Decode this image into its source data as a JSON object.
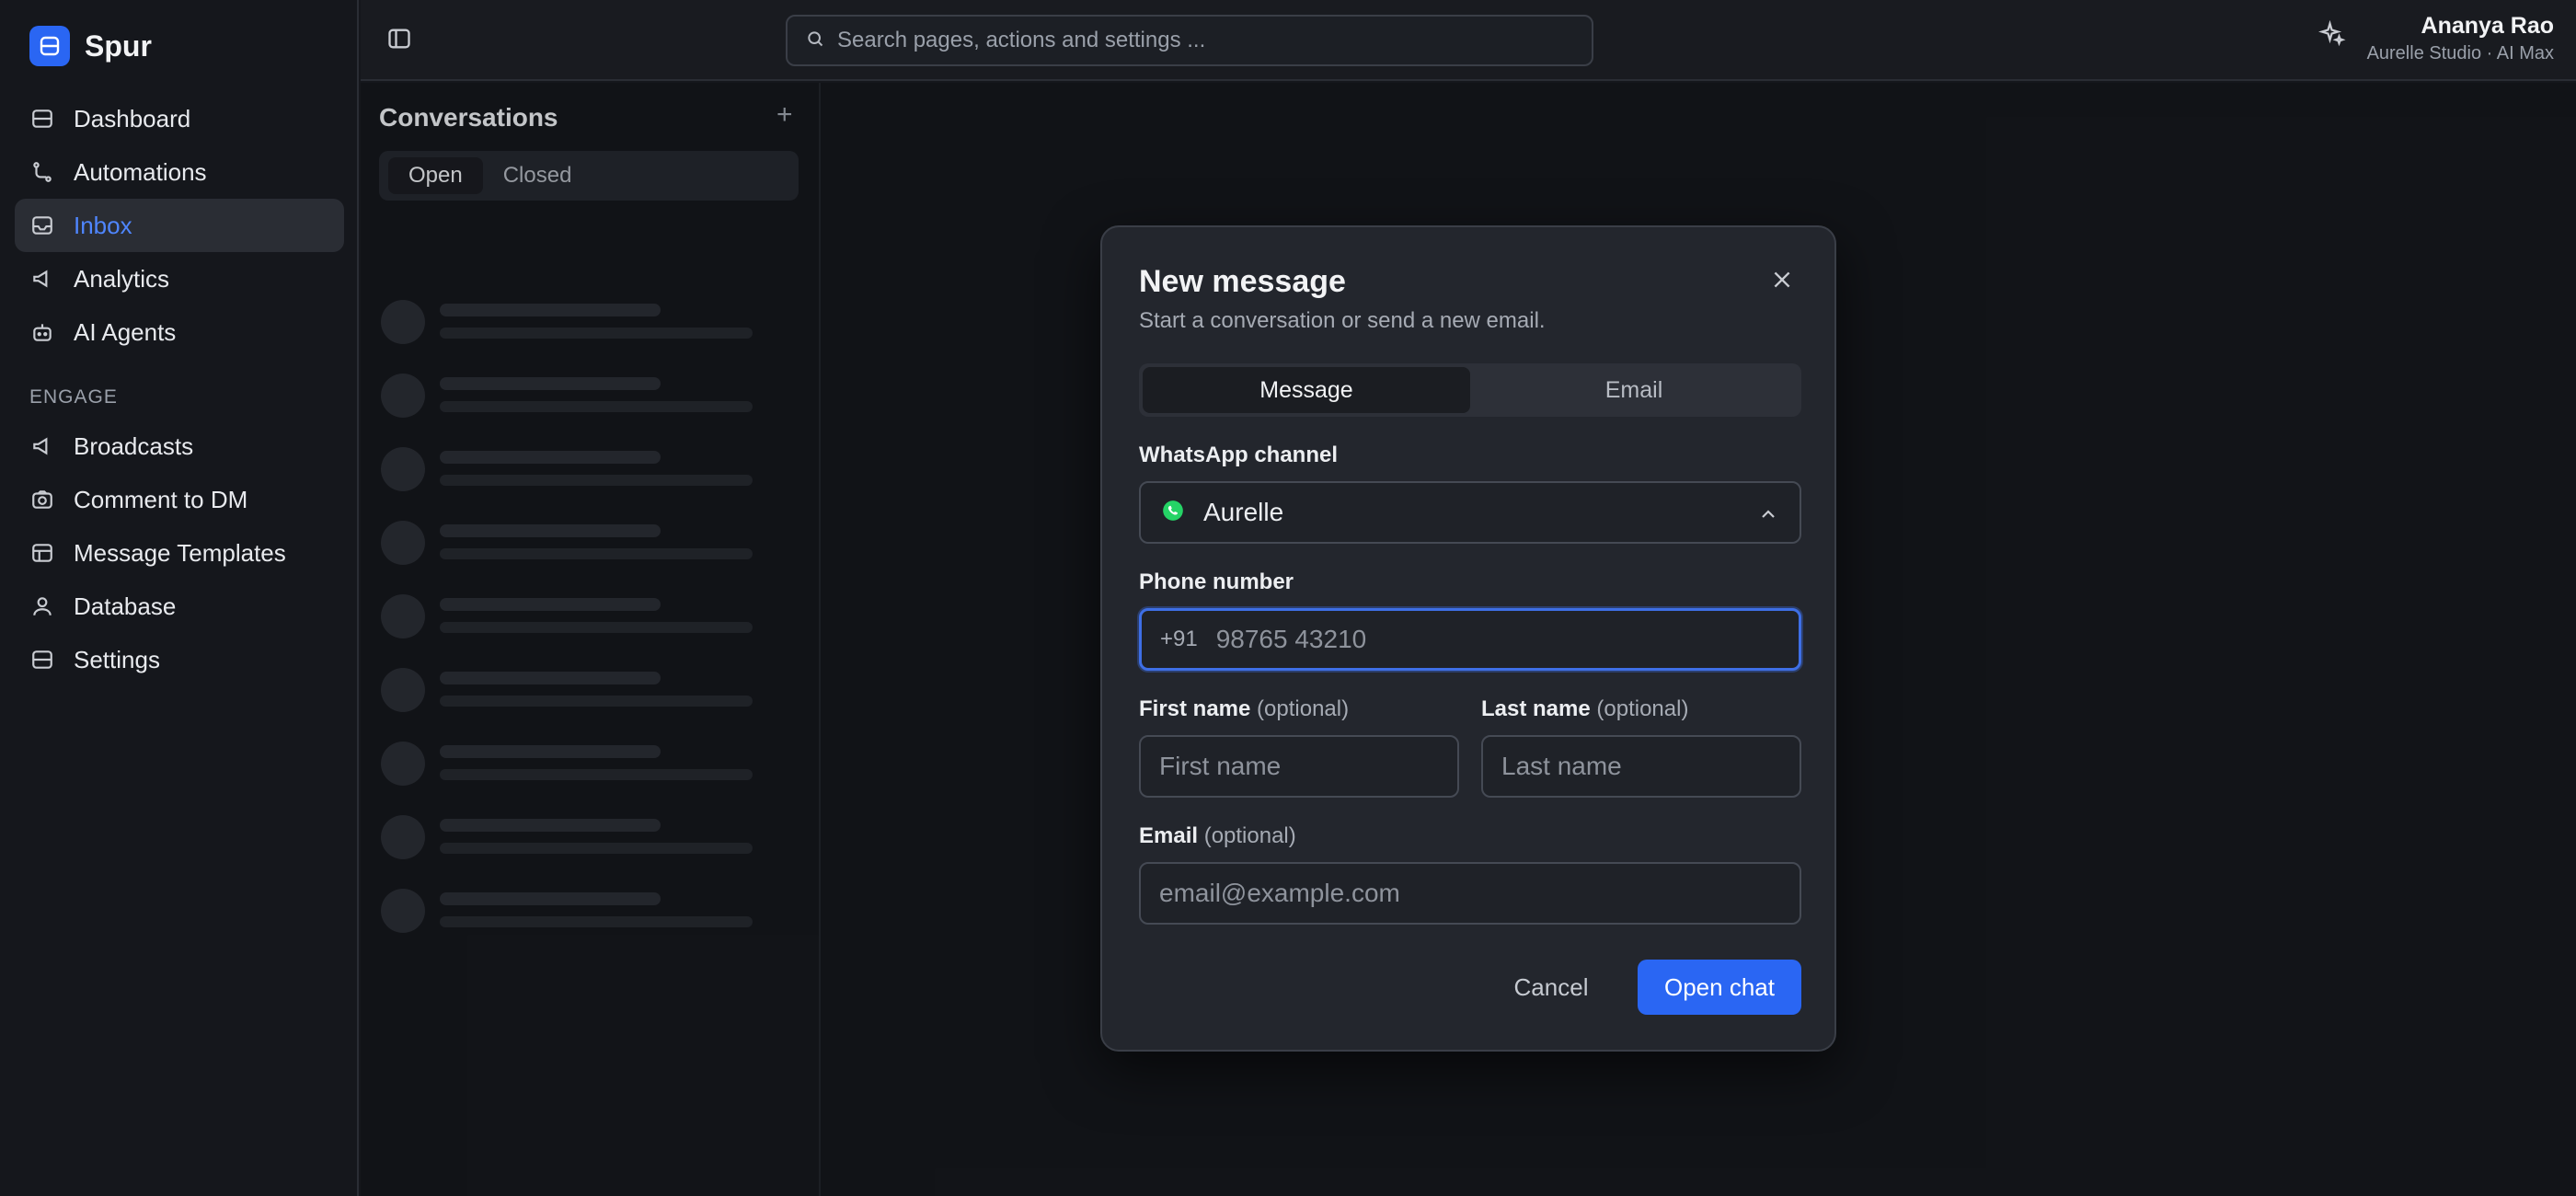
{
  "brand": {
    "name": "Spur",
    "accent": "#2a66f3"
  },
  "sidebar": {
    "items": [
      {
        "label": "Dashboard",
        "icon": "dashboard-icon"
      },
      {
        "label": "Automations",
        "icon": "automations-icon"
      },
      {
        "label": "Inbox",
        "icon": "inbox-icon",
        "active": true
      },
      {
        "label": "Analytics",
        "icon": "megaphone-icon"
      },
      {
        "label": "AI Agents",
        "icon": "bot-icon"
      }
    ],
    "section_label": "ENGAGE",
    "engage_items": [
      {
        "label": "Broadcasts",
        "icon": "megaphone-icon"
      },
      {
        "label": "Comment to DM",
        "icon": "camera-icon"
      },
      {
        "label": "Message Templates",
        "icon": "template-icon"
      },
      {
        "label": "Database",
        "icon": "user-icon"
      },
      {
        "label": "Settings",
        "icon": "settings-icon"
      }
    ]
  },
  "topbar": {
    "search_placeholder": "Search pages, actions and settings ...",
    "user_name": "Ananya Rao",
    "user_sub": "Aurelle Studio · AI Max"
  },
  "conversations": {
    "title": "Conversations",
    "add": "+",
    "tabs": [
      "Open",
      "Closed"
    ]
  },
  "modal": {
    "title": "New message",
    "subtitle": "Start a conversation or send a new email.",
    "tabs": [
      "Message",
      "Email"
    ],
    "channel_label": "WhatsApp channel",
    "channel_value": "Aurelle",
    "phone_label": "Phone number",
    "phone_prefix": "+91",
    "phone_placeholder": "98765 43210",
    "first_name_label": "First name",
    "first_name_placeholder": "First name",
    "last_name_label": "Last name",
    "last_name_placeholder": "Last name",
    "optional": "(optional)",
    "email_label": "Email",
    "email_placeholder": "email@example.com",
    "cancel": "Cancel",
    "open_chat": "Open chat"
  }
}
